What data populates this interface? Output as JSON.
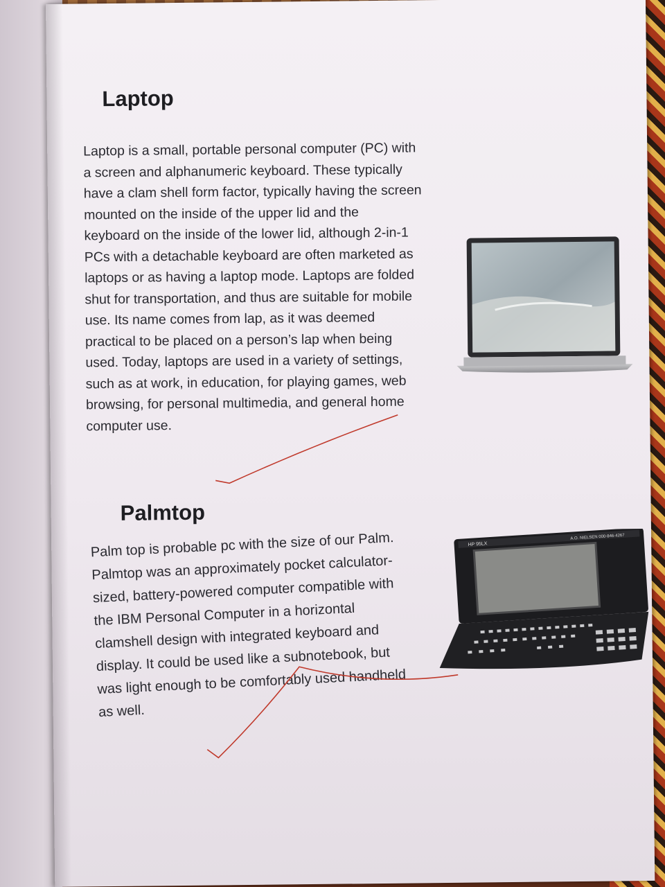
{
  "laptop": {
    "heading": "Laptop",
    "lines": [
      "Laptop is a small, portable personal computer (PC) with",
      "a screen and alphanumeric keyboard. These typically",
      "have a clam shell form factor, typically having the screen",
      "mounted on the inside of the upper lid and the",
      "keyboard on the inside of the lower lid, although 2-in-1",
      "PCs with a detachable keyboard are often marketed as",
      "laptops or as having a laptop mode. Laptops are folded",
      "shut for transportation, and thus are suitable for mobile",
      "use.  Its name comes from lap, as it was deemed",
      "practical to be placed on a person’s lap when being",
      "used. Today, laptops are used in a variety of settings,",
      "such as at work, in education, for playing games, web",
      "browsing, for personal multimedia, and general home",
      "computer use."
    ],
    "image": "laptop-photo"
  },
  "palmtop": {
    "heading": "Palmtop",
    "lines": [
      "Palm top is probable pc with the size of our Palm.",
      "Palmtop  was an approximately pocket calculator-",
      "sized, battery-powered computer compatible with",
      "the IBM Personal Computer in a horizontal",
      "clamshell design with integrated keyboard and",
      "display. It could be used like a subnotebook, but",
      "was light enough to be comfortably used handheld",
      "as well."
    ],
    "image": "palmtop-photo",
    "device_labels": [
      "HP 95LX",
      "A.O. NIELSEN 000-846-4267"
    ]
  },
  "colors": {
    "ink": "#2a2a30",
    "teacher_mark": "#c0392b"
  }
}
